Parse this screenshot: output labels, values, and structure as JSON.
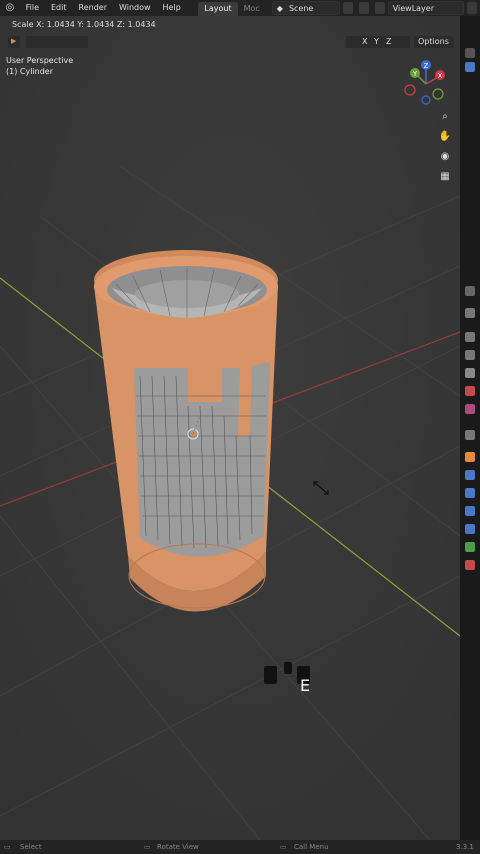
{
  "menu": [
    "File",
    "Edit",
    "Render",
    "Window",
    "Help"
  ],
  "workspaces": {
    "active": "Layout",
    "next": "Moc"
  },
  "scene": "Scene",
  "view_layer": "ViewLayer",
  "scale_readout": {
    "label": "Scale X: 1.0434  Y: 1.0434  Z: 1.0434"
  },
  "viewport": {
    "perspective": "User Perspective",
    "object": "(1) Cylinder"
  },
  "axes": {
    "x": "X",
    "y": "Y",
    "z": "Z"
  },
  "header": {
    "options": "Options"
  },
  "key_overlay": "E",
  "status": {
    "select": "Select",
    "rotate": "Rotate View",
    "context": "Call Menu",
    "version": "3.3.1"
  }
}
